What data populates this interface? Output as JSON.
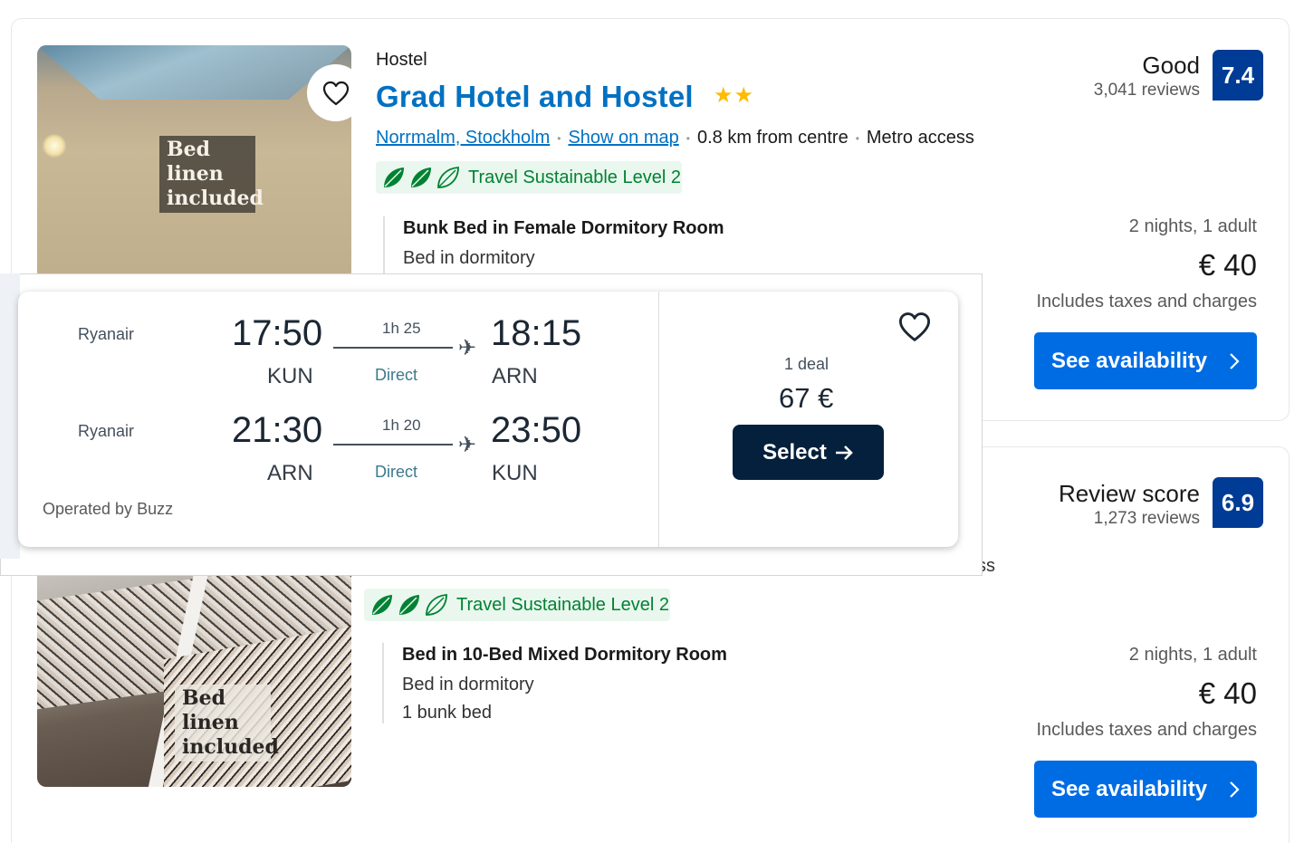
{
  "hotel1": {
    "type": "Hostel",
    "name": "Grad Hotel and Hostel",
    "stars": "★★",
    "location_link": "Norrmalm, Stockholm",
    "map_link": "Show on map",
    "distance": "0.8 km from centre",
    "access": "Metro access",
    "sustainability": "Travel Sustainable Level 2",
    "photo_tag": "Bed linen included",
    "room_name": "Bunk Bed in Female Dormitory Room",
    "room_type": "Bed in dormitory",
    "score_word": "Good",
    "reviews": "3,041 reviews",
    "score": "7.4",
    "nights": "2 nights, 1 adult",
    "price": "€ 40",
    "taxes": "Includes taxes and charges",
    "cta": "See availability"
  },
  "hotel2": {
    "sustainability": "Travel Sustainable Level 2",
    "photo_tag": "Bed linen included",
    "room_name": "Bed in 10-Bed Mixed Dormitory Room",
    "room_type": "Bed in dormitory",
    "beds": "1 bunk bed",
    "score_word": "Review score",
    "reviews": "1,273 reviews",
    "score": "6.9",
    "nights": "2 nights, 1 adult",
    "price": "€ 40",
    "taxes": "Includes taxes and charges",
    "cta": "See availability",
    "partial_text": "ss"
  },
  "flight": {
    "outbound": {
      "carrier": "Ryanair",
      "depart_time": "17:50",
      "depart_airport": "KUN",
      "duration": "1h 25",
      "stops": "Direct",
      "arrive_time": "18:15",
      "arrive_airport": "ARN"
    },
    "inbound": {
      "carrier": "Ryanair",
      "depart_time": "21:30",
      "depart_airport": "ARN",
      "duration": "1h 20",
      "stops": "Direct",
      "arrive_time": "23:50",
      "arrive_airport": "KUN"
    },
    "operated_by": "Operated by Buzz",
    "deals": "1 deal",
    "price": "67 €",
    "select_label": "Select"
  },
  "colors": {
    "brand_blue": "#0071c2",
    "button_blue": "#006ce4",
    "score_navy": "#003b95",
    "eco_green": "#008234",
    "flight_navy": "#05203c",
    "star_yellow": "#febb02"
  }
}
